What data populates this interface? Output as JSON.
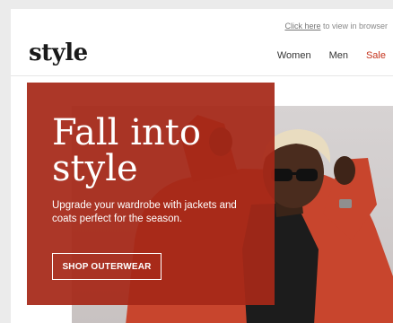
{
  "topbar": {
    "link_text": "Click here",
    "suffix_text": " to view in browser"
  },
  "header": {
    "logo": "style",
    "nav": [
      {
        "label": "Women"
      },
      {
        "label": "Men"
      },
      {
        "label": "Sale"
      }
    ]
  },
  "hero": {
    "title_line1": "Fall into",
    "title_line2": "style",
    "subtitle": "Upgrade your wardrobe with jackets and coats perfect for the season.",
    "cta_label": "SHOP OUTERWEAR"
  },
  "colors": {
    "accent_red": "#a62818",
    "sale_red": "#c4321b",
    "jacket_red": "#c8452d"
  }
}
